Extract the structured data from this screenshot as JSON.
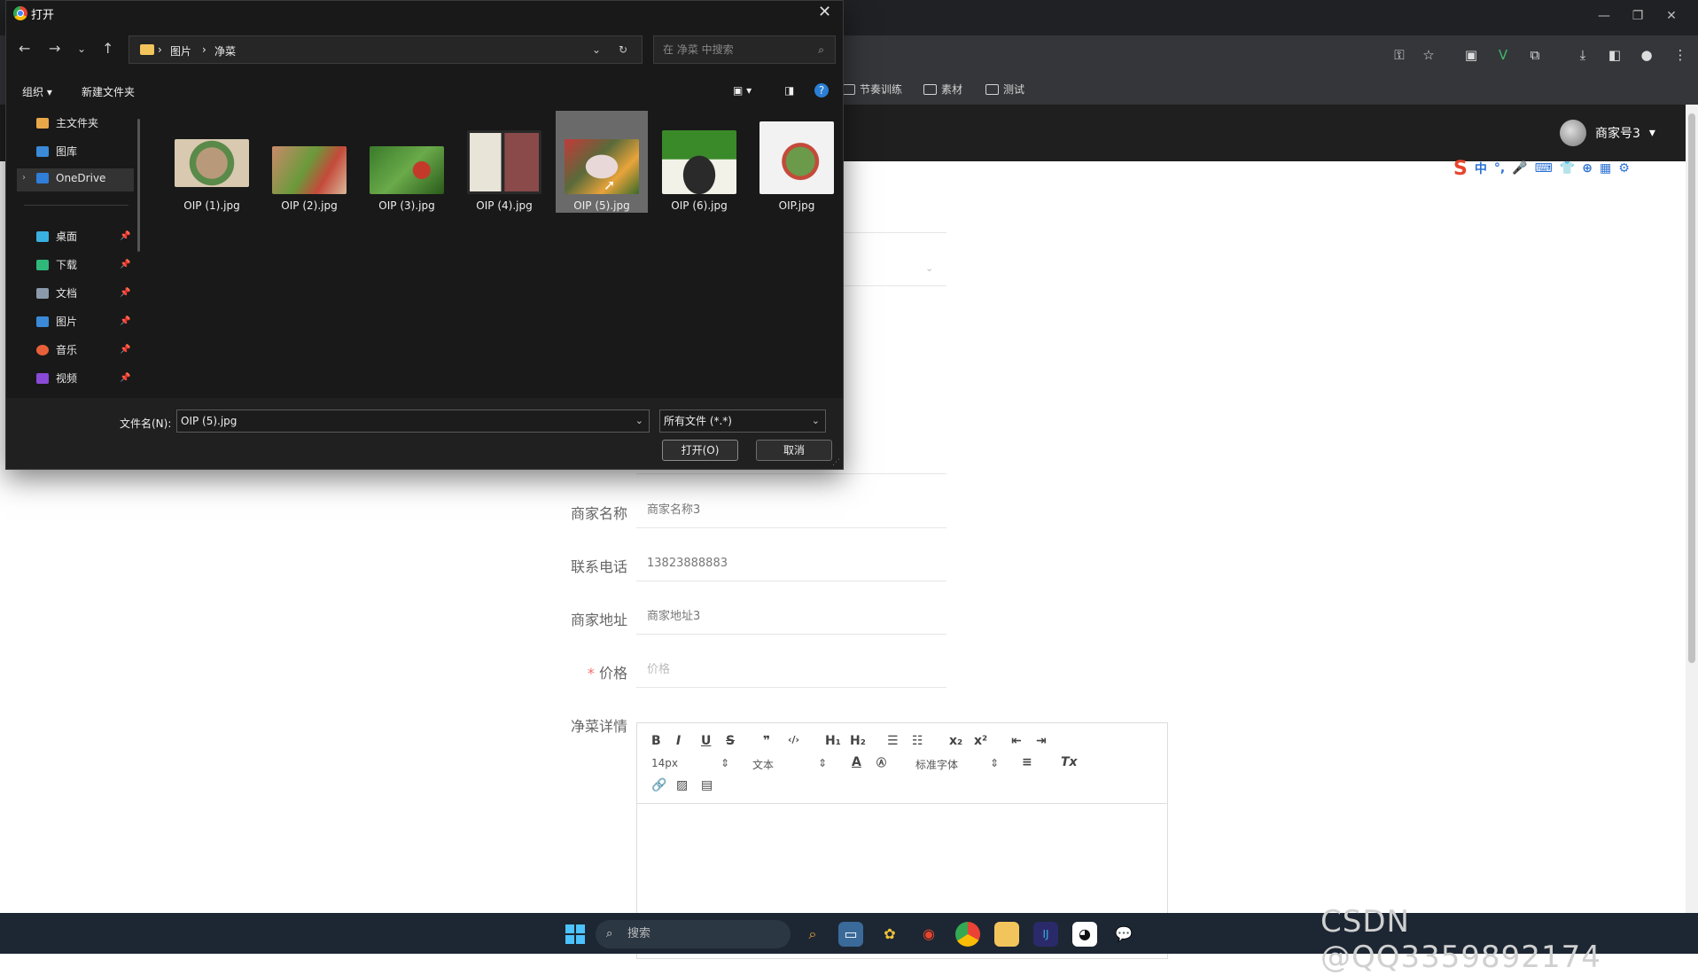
{
  "browser": {
    "bookmarks": [
      "节奏训练",
      "素材",
      "测试"
    ]
  },
  "app": {
    "user_name": "商家号3",
    "user_menu_caret": "▾"
  },
  "ime": {
    "items": [
      "S",
      "中",
      "°,",
      "🎤",
      "⌨",
      "👕",
      "⊕",
      "▦",
      "⚙"
    ]
  },
  "form": {
    "merchant_name_label": "商家名称",
    "merchant_name_value": "商家名称3",
    "phone_label": "联系电话",
    "phone_value": "13823888883",
    "address_label": "商家地址",
    "address_value": "商家地址3",
    "price_required_mark": "*",
    "price_label": "价格",
    "price_placeholder": "价格",
    "details_label": "净菜详情",
    "editor": {
      "font_size": "14px",
      "block_type": "文本",
      "font_family": "标准字体"
    }
  },
  "dialog": {
    "title": "打开",
    "breadcrumb": [
      "图片",
      "净菜"
    ],
    "search_placeholder": "在 净菜 中搜索",
    "commands": {
      "organize": "组织 ▾",
      "new_folder": "新建文件夹"
    },
    "nav": {
      "home": "主文件夹",
      "gallery": "图库",
      "onedrive": "OneDrive",
      "desktop": "桌面",
      "downloads": "下载",
      "documents": "文档",
      "pictures": "图片",
      "music": "音乐",
      "videos": "视频"
    },
    "files": [
      {
        "name": "OIP (1).jpg",
        "colors": [
          "#b89a7a",
          "#5a8a4a",
          "#d9c9b0"
        ]
      },
      {
        "name": "OIP (2).jpg",
        "colors": [
          "#c98a6a",
          "#6a9a3a",
          "#c44a3a"
        ]
      },
      {
        "name": "OIP (3).jpg",
        "colors": [
          "#3a7a2a",
          "#c43a2a",
          "#6aaa4a"
        ]
      },
      {
        "name": "OIP (4).jpg",
        "colors": [
          "#2a2a2a",
          "#e8e4d8",
          "#8a4a4a"
        ]
      },
      {
        "name": "OIP (5).jpg",
        "colors": [
          "#5a6a3a",
          "#e8d8d8",
          "#c43a3a"
        ]
      },
      {
        "name": "OIP (6).jpg",
        "colors": [
          "#3a8a2a",
          "#f2f2e8",
          "#2a2a2a"
        ]
      },
      {
        "name": "OIP.jpg",
        "colors": [
          "#f2f2f2",
          "#6a9a4a",
          "#c44a3a"
        ]
      }
    ],
    "selected_file": "OIP (5).jpg",
    "filename_label": "文件名(N):",
    "filename_value": "OIP (5).jpg",
    "filetype_value": "所有文件 (*.*)",
    "open_button": "打开(O)",
    "cancel_button": "取消"
  },
  "taskbar": {
    "search_placeholder": "搜索"
  },
  "watermark": "CSDN @QQ3359892174"
}
